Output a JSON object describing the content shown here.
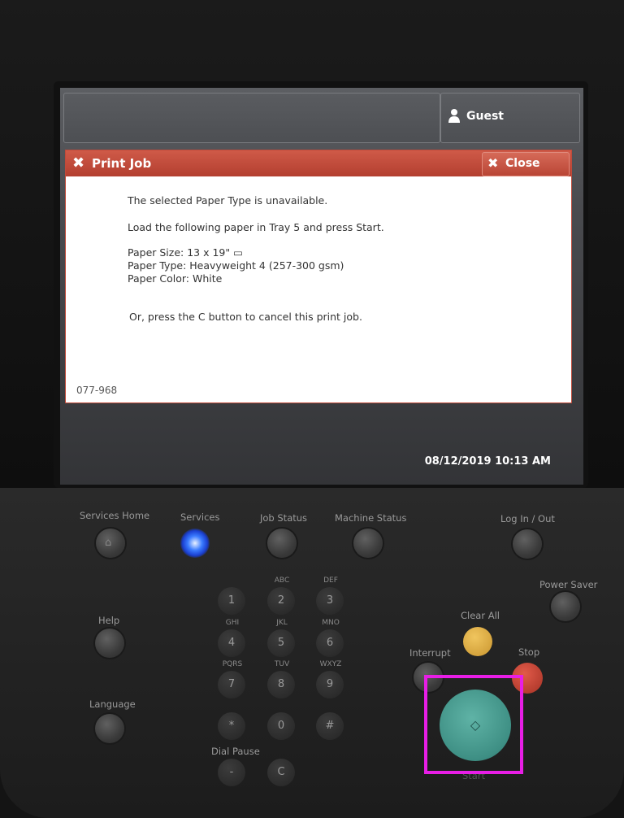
{
  "screen": {
    "user": "Guest",
    "dialog": {
      "title": "Print Job",
      "close_label": "Close",
      "line1": "The selected Paper Type is unavailable.",
      "line2": "Load the following paper in Tray 5 and press Start.",
      "paper_size": "Paper Size: 13 x 19\" ▭",
      "paper_type": "Paper Type: Heavyweight 4 (257-300 gsm)",
      "paper_color": "Paper Color: White",
      "cancel_hint": "Or, press the C button to cancel this print job.",
      "code": "077-968"
    },
    "datetime": "08/12/2019  10:13 AM"
  },
  "panel": {
    "services_home": "Services Home",
    "services": "Services",
    "job_status": "Job Status",
    "machine_status": "Machine Status",
    "log_in_out": "Log In / Out",
    "power_saver": "Power Saver",
    "help": "Help",
    "language": "Language",
    "clear_all": "Clear All",
    "interrupt": "Interrupt",
    "stop": "Stop",
    "start": "Start",
    "dial_pause": "Dial Pause",
    "keys": {
      "k1": "1",
      "k2": "2",
      "k3": "3",
      "k4": "4",
      "k5": "5",
      "k6": "6",
      "k7": "7",
      "k8": "8",
      "k9": "9",
      "star": "*",
      "k0": "0",
      "hash": "#",
      "dash": "-",
      "c": "C",
      "abc": "ABC",
      "def": "DEF",
      "ghi": "GHI",
      "jkl": "JKL",
      "mno": "MNO",
      "pqrs": "PQRS",
      "tuv": "TUV",
      "wxyz": "WXYZ"
    }
  },
  "colors": {
    "dialog_header": "#c04a3a",
    "services_led": "#3a7bff",
    "start_button": "#4a9d92",
    "clear_all_button": "#d9a640",
    "stop_button": "#b83a2c",
    "highlight": "#e81ee6"
  }
}
